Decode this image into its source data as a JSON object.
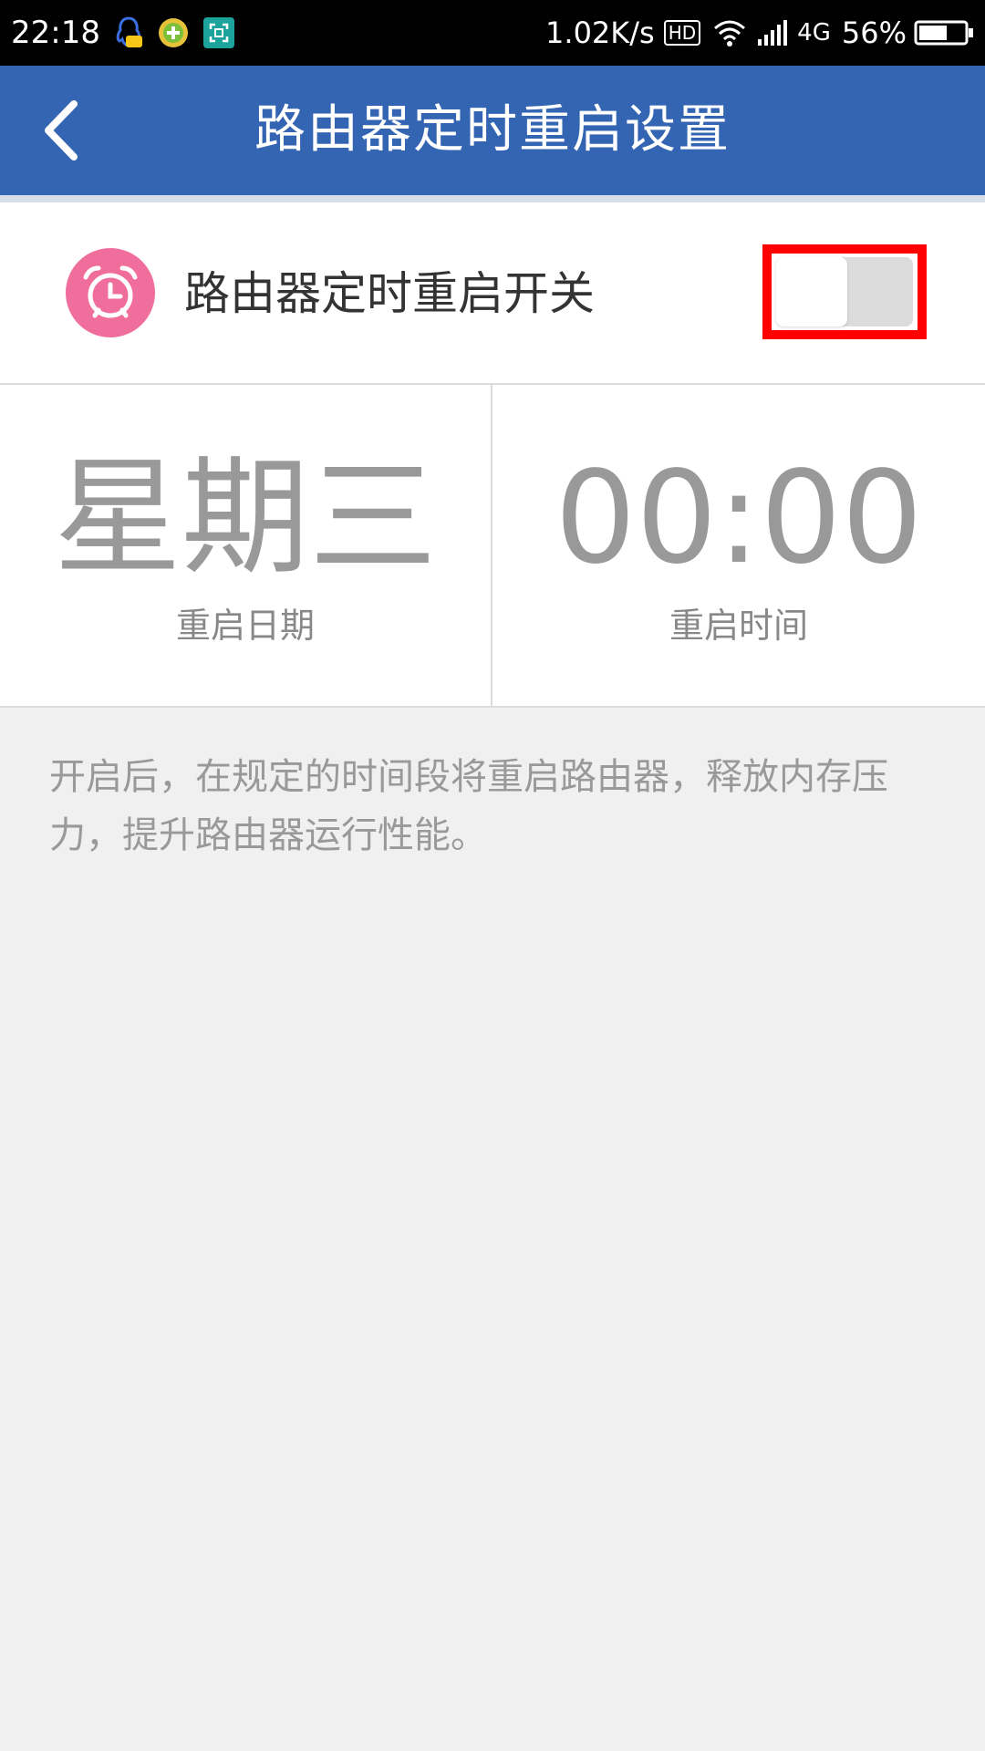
{
  "status_bar": {
    "time": "22:18",
    "network_speed": "1.02K/s",
    "hd_label": "HD",
    "network_type": "4G",
    "battery_percent": "56%"
  },
  "app_bar": {
    "title": "路由器定时重启设置",
    "back_icon": "chevron-left-icon"
  },
  "toggle_row": {
    "label": "路由器定时重启开关",
    "icon": "alarm-clock-icon",
    "icon_color": "#f06e9c",
    "switch_on": false
  },
  "schedule": {
    "day_value": "星期三",
    "day_label": "重启日期",
    "time_value": "00:00",
    "time_label": "重启时间"
  },
  "description": "开启后，在规定的时间段将重启路由器，释放内存压力，提升路由器运行性能。",
  "colors": {
    "app_bar": "#3465b3",
    "highlight_outline": "#ff0000"
  }
}
